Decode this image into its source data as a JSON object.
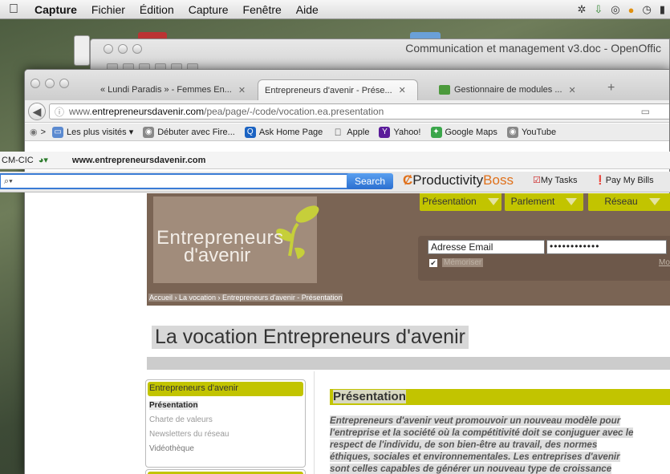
{
  "menubar": {
    "app": "Capture",
    "items": [
      "Fichier",
      "Édition",
      "Capture",
      "Fenêtre",
      "Aide"
    ]
  },
  "openoffice": {
    "title": "Communication et management v3.doc - OpenOffic"
  },
  "tabs": [
    {
      "label": "« Lundi Paradis » - Femmes En...",
      "close": "✕"
    },
    {
      "label": "Entrepreneurs d'avenir - Prése...",
      "close": "✕"
    },
    {
      "label": "Gestionnaire de modules ...",
      "close": "✕"
    }
  ],
  "tab_new": "+",
  "url": {
    "prefix": "www.",
    "domain": "entrepreneursdavenir.com",
    "path": "/pea/page/-/code/vocation.ea.presentation"
  },
  "bookmarks": [
    {
      "label": "Les plus visités ▾",
      "icon": "folder-icon",
      "color": "#5b8ad0"
    },
    {
      "label": "Débuter avec Fire...",
      "icon": "firefox-icon",
      "color": "#888"
    },
    {
      "label": "Ask Home Page",
      "icon": "ask-icon",
      "color": "#1b63c2"
    },
    {
      "label": "Apple",
      "icon": "apple-icon",
      "color": "#555"
    },
    {
      "label": "Yahoo!",
      "icon": "yahoo-icon",
      "color": "#5a1b9a"
    },
    {
      "label": "Google Maps",
      "icon": "maps-icon",
      "color": "#3aa64a"
    },
    {
      "label": "YouTube",
      "icon": "globe-icon",
      "color": "#888"
    }
  ],
  "cmbar": {
    "label": "CM-CIC",
    "site": "www.entrepreneursdavenir.com"
  },
  "toolbar": {
    "search_placeholder": "",
    "search_button": "Search",
    "brand_a": "Productivity",
    "brand_b": "Boss",
    "my_tasks": "My Tasks",
    "pay_bills": "Pay My Bills"
  },
  "site": {
    "logo_line1": "Entrepreneurs",
    "logo_line2": "d'avenir",
    "nav": [
      "Présentation",
      "Parlement",
      "Réseau"
    ],
    "email_value": "Adresse Email",
    "password_value": "••••••••••••",
    "remember_label": "Mémoriser",
    "forgot_label": "Mot d",
    "breadcrumb": "Accueil › La vocation › Entrepreneurs d'avenir - Présentation",
    "page_title": "La vocation Entrepreneurs d'avenir",
    "side_heading": "Entrepreneurs d'avenir",
    "side_items": [
      "Présentation",
      "Charte de valeurs",
      "Newsletters du réseau",
      "Vidéothèque"
    ],
    "section_heading": "Présentation",
    "body_lines": [
      "Entrepreneurs d'avenir veut promouvoir un nouveau modèle pour",
      "l'entreprise et la société où la compétitivité doit se conjuguer avec le",
      "respect de l'individu, de son bien-être au travail, des normes",
      "éthiques, sociales et environnementales. Les entreprises d'avenir",
      "sont celles capables de générer un nouveau type de croissance"
    ]
  },
  "colors": {
    "accent": "#c2c400",
    "header_brown": "#7a6454",
    "search_blue": "#3a7bd5"
  }
}
